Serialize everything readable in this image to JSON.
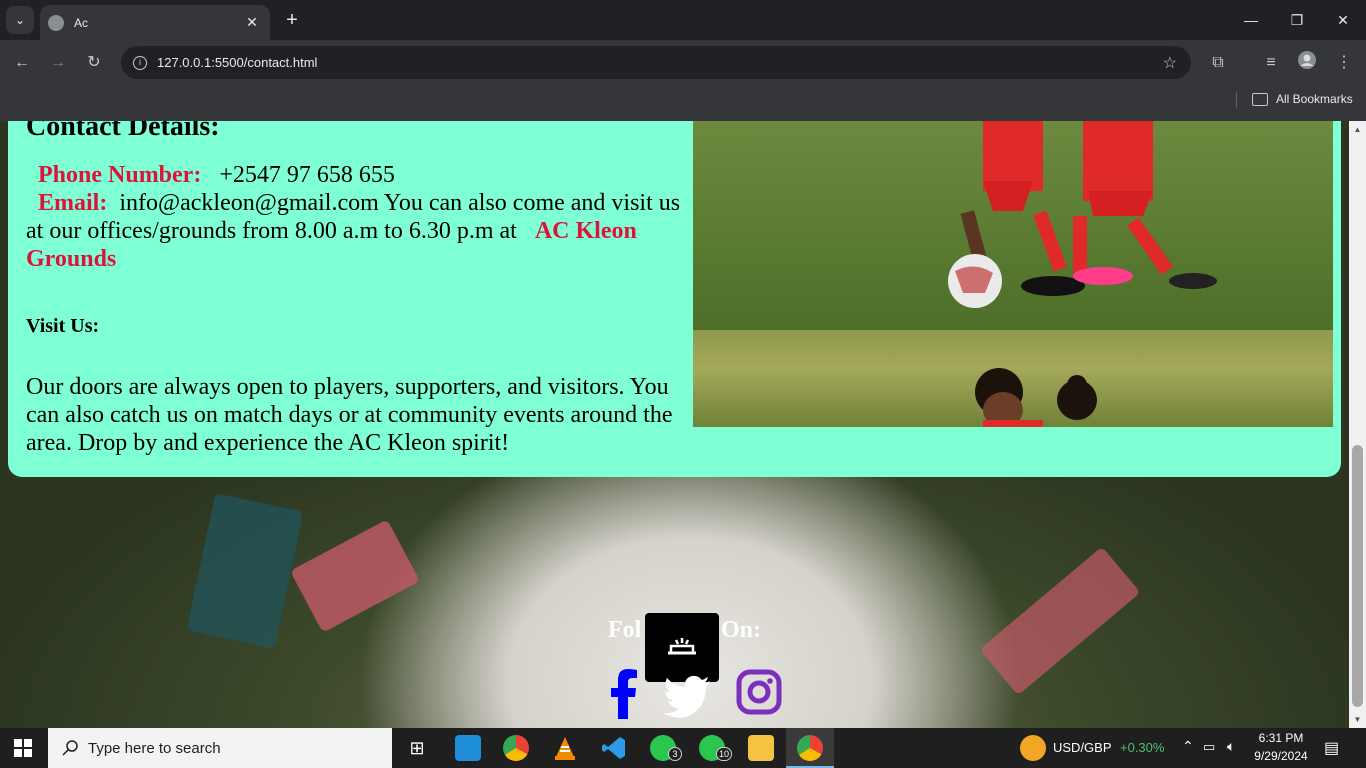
{
  "browser": {
    "tab_title": "Ac",
    "url": "127.0.0.1:5500/contact.html",
    "bookmarks_label": "All Bookmarks"
  },
  "page": {
    "contact_title": "Contact Details:",
    "phone_label": "Phone Number:",
    "phone_value": "+2547 97 658 655",
    "email_label": "Email:",
    "email_value": "info@ackleon@gmail.com",
    "visit_text": "You can also come and visit us at our offices/grounds from 8.00 a.m to 6.30 p.m at",
    "grounds_name": "AC Kleon Grounds",
    "visit_title": "Visit Us:",
    "visit_body": "Our doors are always open to players, supporters, and visitors. You can also catch us on match days or at community events around the area. Drop by and experience the AC Kleon spirit!",
    "follow_part1": "Fol",
    "follow_part2": "On:",
    "social": [
      "facebook-icon",
      "twitter-icon",
      "instagram-icon"
    ]
  },
  "taskbar": {
    "search_placeholder": "Type here to search",
    "whatsapp_badge_1": "3",
    "whatsapp_badge_2": "10",
    "currency_pair": "USD/GBP",
    "currency_change": "+0.30%",
    "time": "6:31 PM",
    "date": "9/29/2024"
  },
  "colors": {
    "card_bg": "#7fffd4",
    "label_red": "#dc143c",
    "currency_up": "#4cc26b"
  }
}
